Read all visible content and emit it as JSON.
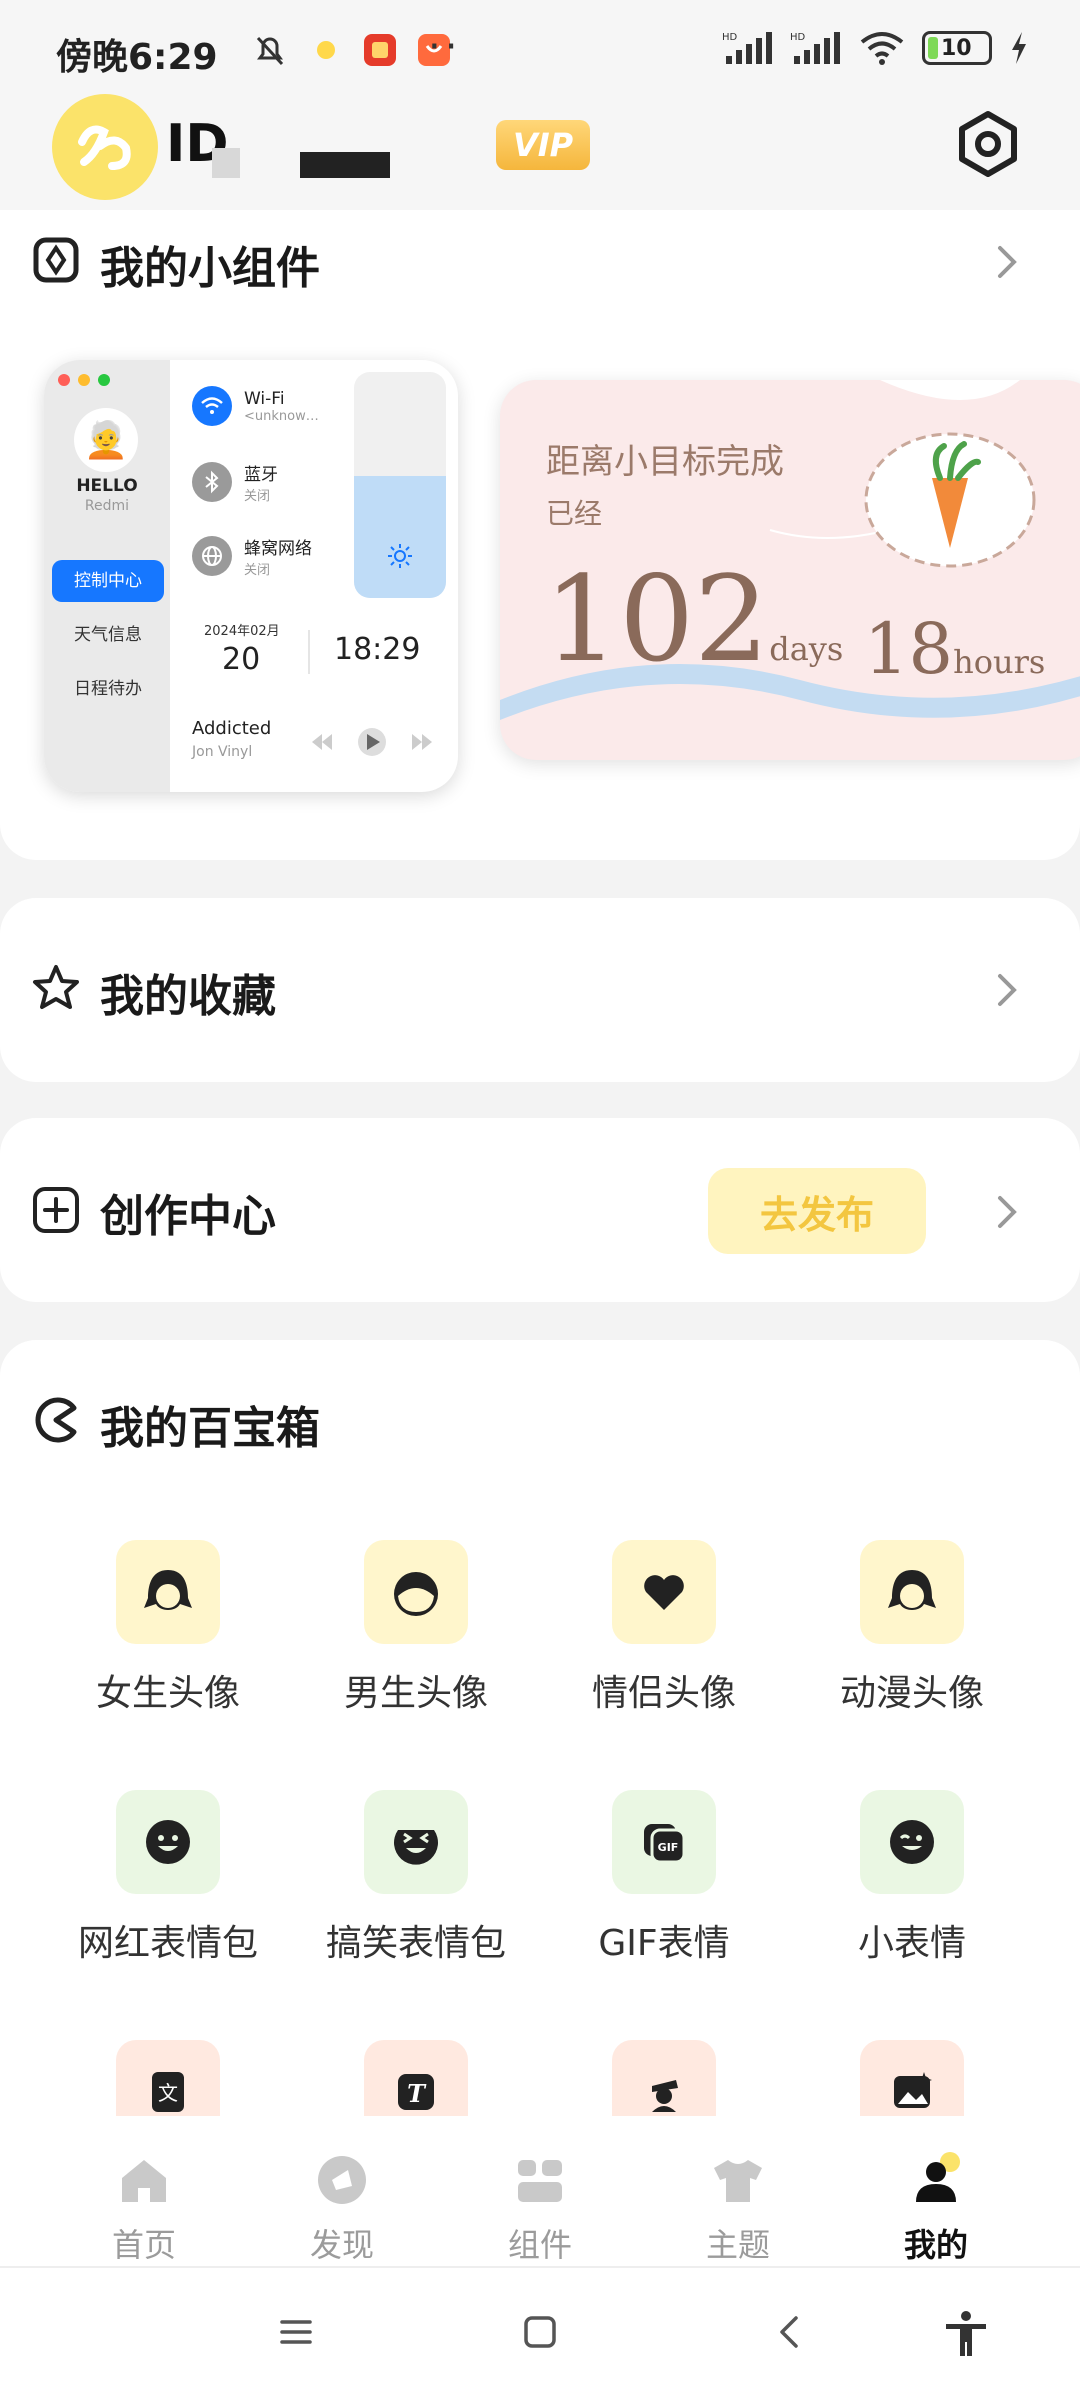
{
  "status_bar": {
    "time": "傍晚6:29",
    "battery": "10"
  },
  "header": {
    "user_id": "ID",
    "vip_label": "VIP"
  },
  "widgets_section": {
    "title": "我的小组件",
    "control_widget": {
      "hello": "HELLO",
      "device": "Redmi",
      "nav_items": [
        "控制中心",
        "天气信息",
        "日程待办"
      ],
      "wifi_label": "Wi-Fi",
      "wifi_status": "<unknow…",
      "bt_label": "蓝牙",
      "bt_status": "关闭",
      "cell_label": "蜂窝网络",
      "cell_status": "关闭",
      "date_month": "2024年02月",
      "date_day": "20",
      "clock": "18:29",
      "song": "Addicted",
      "artist": "Jon Vinyl"
    },
    "countdown_widget": {
      "line1": "距离小目标完成",
      "line2": "已经",
      "days_value": "102",
      "days_unit": "days",
      "hours_value": "18",
      "hours_unit": "hours"
    }
  },
  "favorites_section": {
    "title": "我的收藏"
  },
  "create_section": {
    "title": "创作中心",
    "publish_label": "去发布"
  },
  "toolbox_section": {
    "title": "我的百宝箱",
    "items": [
      {
        "label": "女生头像",
        "icon": "girl-face-icon"
      },
      {
        "label": "男生头像",
        "icon": "boy-face-icon"
      },
      {
        "label": "情侣头像",
        "icon": "heart-icon"
      },
      {
        "label": "动漫头像",
        "icon": "anime-face-icon"
      },
      {
        "label": "网红表情包",
        "icon": "smile-emoji-icon"
      },
      {
        "label": "搞笑表情包",
        "icon": "laugh-emoji-icon"
      },
      {
        "label": "GIF表情",
        "icon": "gif-icon"
      },
      {
        "label": "小表情",
        "icon": "wink-emoji-icon"
      }
    ],
    "row3_icons": [
      "translate-icon",
      "text-icon",
      "person-hat-icon",
      "photo-edit-icon"
    ]
  },
  "bottom_nav": {
    "items": [
      {
        "label": "首页",
        "icon": "home-icon"
      },
      {
        "label": "发现",
        "icon": "discover-icon"
      },
      {
        "label": "组件",
        "icon": "widgets-icon"
      },
      {
        "label": "主题",
        "icon": "shirt-icon"
      },
      {
        "label": "我的",
        "icon": "person-icon"
      }
    ],
    "active_index": 4
  },
  "colors": {
    "accent_yellow": "#fbe36a",
    "publish_bg": "#fff4bf",
    "publish_text": "#f3c640",
    "tile_yellow": "#fff6cc",
    "tile_green": "#eaf7e3",
    "tile_peach": "#ffe9e0",
    "control_blue": "#1677ff"
  }
}
